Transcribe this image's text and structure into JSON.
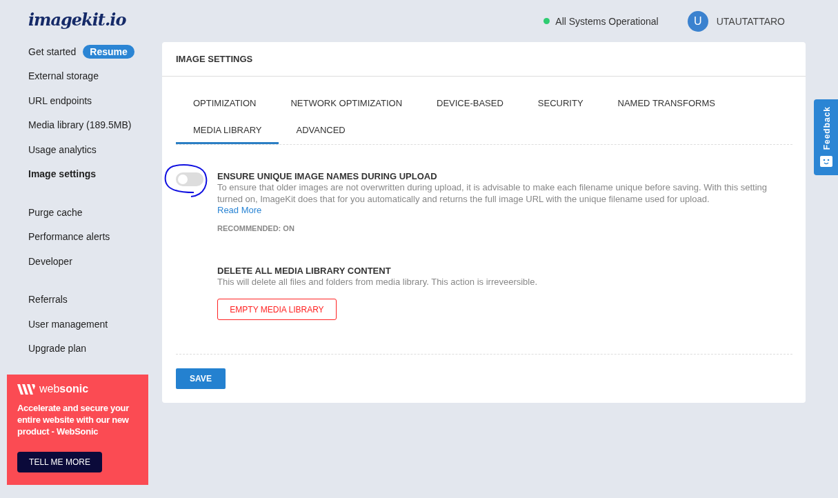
{
  "logo": "imagekit.io",
  "status": {
    "text": "All Systems Operational",
    "color": "#2ecc71"
  },
  "user": {
    "initial": "U",
    "name": "UTAUTATTARO"
  },
  "sidebar": {
    "groups": [
      [
        {
          "label": "Get started",
          "badge": "Resume",
          "selected": false
        },
        {
          "label": "External storage",
          "selected": false
        },
        {
          "label": "URL endpoints",
          "selected": false
        },
        {
          "label": "Media library (189.5MB)",
          "selected": false
        },
        {
          "label": "Usage analytics",
          "selected": false
        },
        {
          "label": "Image settings",
          "selected": true
        }
      ],
      [
        {
          "label": "Purge cache",
          "selected": false
        },
        {
          "label": "Performance alerts",
          "selected": false
        },
        {
          "label": "Developer",
          "selected": false
        }
      ],
      [
        {
          "label": "Referrals",
          "selected": false
        },
        {
          "label": "User management",
          "selected": false
        },
        {
          "label": "Upgrade plan",
          "selected": false
        }
      ]
    ]
  },
  "promo": {
    "brand": "web**sonic**",
    "text": "Accelerate and secure your entire website with our new product - WebSonic",
    "button": "TELL ME MORE"
  },
  "panel": {
    "title": "IMAGE SETTINGS",
    "tab_rows": [
      [
        {
          "label": "OPTIMIZATION",
          "selected": false
        },
        {
          "label": "NETWORK OPTIMIZATION",
          "selected": false
        },
        {
          "label": "DEVICE-BASED",
          "selected": false
        },
        {
          "label": "SECURITY",
          "selected": false
        },
        {
          "label": "NAMED TRANSFORMS",
          "selected": false
        }
      ],
      [
        {
          "label": "MEDIA LIBRARY",
          "selected": true
        },
        {
          "label": "ADVANCED",
          "selected": false
        }
      ]
    ],
    "settings": [
      {
        "kind": "toggle",
        "on": false,
        "title": "ENSURE UNIQUE IMAGE NAMES DURING UPLOAD",
        "description": "To ensure that older images are not overwritten during upload, it is advisable to make each filename unique before saving. With this setting turned on, ImageKit does that for you automatically and returns the full image URL with the unique filename used for upload.",
        "link": "Read More",
        "note": "RECOMMENDED: ON"
      },
      {
        "kind": "danger",
        "title": "DELETE ALL MEDIA LIBRARY CONTENT",
        "description": "This will delete all files and folders from media library. This action is irreveersible.",
        "button": "EMPTY MEDIA LIBRARY"
      }
    ],
    "save": "SAVE"
  },
  "feedback": "Feedback"
}
